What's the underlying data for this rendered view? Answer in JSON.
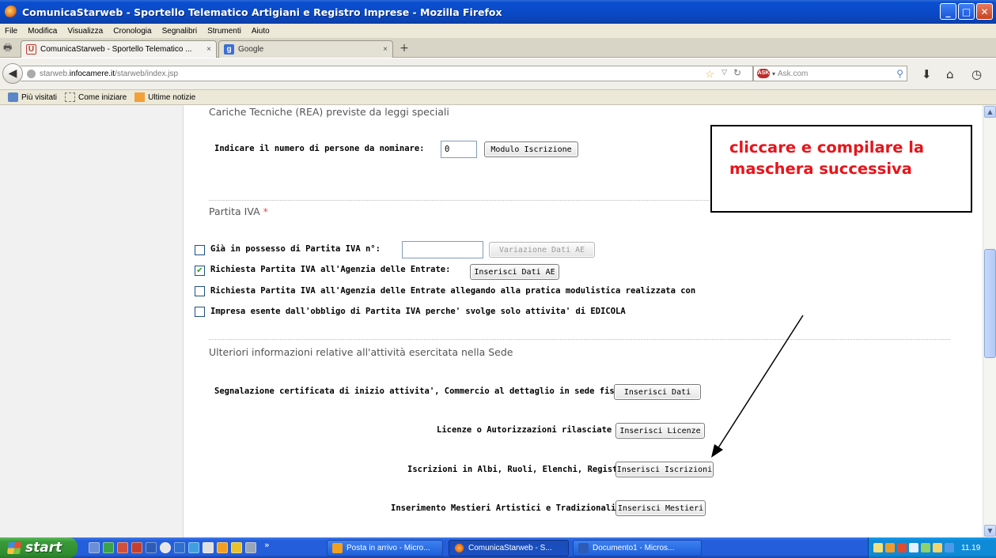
{
  "window": {
    "title": "ComunicaStarweb - Sportello Telematico Artigiani e Registro Imprese - Mozilla Firefox",
    "controls": {
      "minimize": "_",
      "maximize": "□",
      "close": "✕"
    }
  },
  "menu": [
    "File",
    "Modifica",
    "Visualizza",
    "Cronologia",
    "Segnalibri",
    "Strumenti",
    "Aiuto"
  ],
  "tabs": [
    {
      "label": "ComunicaStarweb - Sportello Telematico ...",
      "close": "×",
      "favicon": "U"
    },
    {
      "label": "Google",
      "close": "×",
      "favicon": "g"
    }
  ],
  "new_tab": "+",
  "address": {
    "prefix": "starweb.",
    "domain": "infocamere.it",
    "path": "/starweb/index.jsp"
  },
  "search": {
    "placeholder": "Ask.com",
    "engine": "ASK"
  },
  "bookmarks": [
    "Più visitati",
    "Come iniziare",
    "Ultime notizie"
  ],
  "page": {
    "cariche": {
      "title": "Cariche Tecniche (REA) previste da leggi speciali",
      "label": "Indicare il numero di persone da nominare:",
      "value": "0",
      "button": "Modulo Iscrizione"
    },
    "iva": {
      "title": "Partita IVA",
      "required_mark": "*",
      "opt1_label": "Già in possesso di Partita IVA n°:",
      "opt1_value": "",
      "opt1_button": "Variazione Dati AE",
      "opt2_label": "Richiesta Partita IVA all'Agenzia delle Entrate:",
      "opt2_button": "Inserisci Dati AE",
      "opt3_label": "Richiesta Partita IVA all'Agenzia delle Entrate allegando alla pratica modulistica realizzata con",
      "opt4_label": "Impresa esente dall'obbligo di Partita IVA perche' svolge solo attivita' di EDICOLA",
      "checked": [
        false,
        true,
        false,
        false
      ]
    },
    "ulteriori": {
      "title": "Ulteriori informazioni relative all'attività esercitata nella Sede",
      "scia_label": "Segnalazione certificata di inizio attivita', Commercio al dettaglio in sede fissa",
      "scia_button": "Inserisci Dati",
      "licenze_label": "Licenze o Autorizzazioni rilasciate",
      "licenze_button": "Inserisci Licenze",
      "iscrizioni_label": "Iscrizioni in Albi, Ruoli, Elenchi, Registri",
      "iscrizioni_button": "Inserisci Iscrizioni",
      "mestieri_label": "Inserimento Mestieri Artistici e Tradizionali",
      "mestieri_button": "Inserisci Mestieri"
    }
  },
  "callout": {
    "line1": "cliccare e compilare la",
    "line2": "maschera successiva"
  },
  "taskbar": {
    "start": "start",
    "more": "»",
    "tasks": [
      "Posta in arrivo - Micro...",
      "ComunicaStarweb - S...",
      "Documento1 - Micros..."
    ],
    "clock": "11.19"
  },
  "colors": {
    "callout_text": "#e8141a",
    "required": "#d9534f",
    "titlebar": "#0a49c6"
  }
}
